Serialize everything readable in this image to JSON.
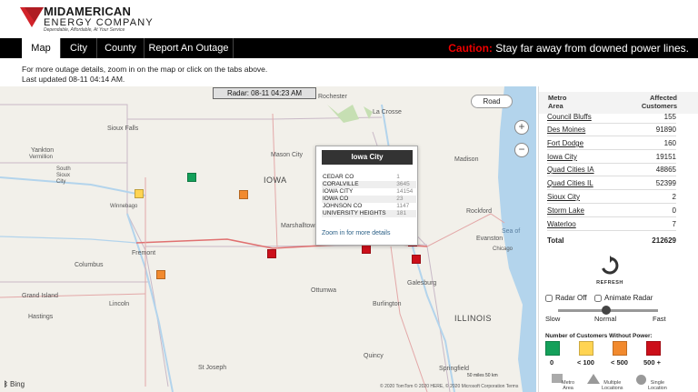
{
  "header": {
    "logo_line1": "MIDAMERICAN",
    "logo_line2": "ENERGY COMPANY",
    "logo_tagline": "Dependable, Affordable, At Your Service"
  },
  "nav": {
    "tabs": [
      {
        "label": "Map",
        "active": true
      },
      {
        "label": "City"
      },
      {
        "label": "County"
      },
      {
        "label": "Report An Outage"
      }
    ],
    "caution_word": "Caution:",
    "caution_text": "Stay far away from downed power lines."
  },
  "info": {
    "line1": "For more outage details, zoom in on the map or click on the tabs above.",
    "line2": "Last updated 08-11 04:14 AM."
  },
  "map": {
    "radar_label": "Radar: 08-11 04:23 AM",
    "road_button": "Road",
    "zoom_in": "+",
    "zoom_out": "−",
    "labels": {
      "sioux_falls": "Sioux Falls",
      "yankton": "Yankton",
      "vermillion": "Vermillion",
      "south_sioux": "South Sioux City",
      "mason_city": "Mason City",
      "iowa": "IOWA",
      "waterloo": "Waterloo",
      "marshalltown": "Marshalltown",
      "fort_dodge": "Fort Dodge",
      "winnebago": "Winnebago",
      "fremont": "Fremont",
      "columbus": "Columbus",
      "grand_island": "Grand Island",
      "lincoln": "Lincoln",
      "hastings": "Hastings",
      "ottumwa": "Ottumwa",
      "burlington": "Burlington",
      "galesburg": "Galesburg",
      "illinois": "ILLINOIS",
      "quincy": "Quincy",
      "springfield": "Springfield",
      "st_joseph": "St Joseph",
      "rochester": "Rochester",
      "la_crosse": "La Crosse",
      "madison": "Madison",
      "rockford": "Rockford",
      "evanston": "Evanston",
      "sea_of": "Sea of",
      "chicago": "Chicago"
    },
    "popup": {
      "title": "Iowa City",
      "rows": [
        [
          "CEDAR CO",
          "1"
        ],
        [
          "CORALVILLE",
          "3645"
        ],
        [
          "IOWA CITY",
          "14154"
        ],
        [
          "IOWA CO",
          "23"
        ],
        [
          "JOHNSON CO",
          "1147"
        ],
        [
          "UNIVERSITY HEIGHTS",
          "181"
        ]
      ],
      "link": "Zoom in for more details"
    },
    "bing": "Bing",
    "copyright": "© 2020 TomTom © 2020 HERE, © 2020 Microsoft Corporation  Terms",
    "scale": "50 miles  50 km"
  },
  "table": {
    "col1_line1": "Metro",
    "col1_line2": "Area",
    "col2_line1": "Affected",
    "col2_line2": "Customers",
    "rows": [
      [
        "Council Bluffs",
        "155"
      ],
      [
        "Des Moines",
        "91890"
      ],
      [
        "Fort Dodge",
        "160"
      ],
      [
        "Iowa City",
        "19151"
      ],
      [
        "Quad Cities IA",
        "48865"
      ],
      [
        "Quad Cities IL",
        "52399"
      ],
      [
        "Sioux City",
        "2"
      ],
      [
        "Storm Lake",
        "0"
      ],
      [
        "Waterloo",
        "7"
      ]
    ],
    "total_label": "Total",
    "total_value": "212629"
  },
  "controls": {
    "refresh": "REFRESH",
    "radar_off": "Radar Off",
    "animate_radar": "Animate Radar",
    "slow": "Slow",
    "normal": "Normal",
    "fast": "Fast"
  },
  "legend": {
    "title": "Number of Customers Without Power:",
    "items": [
      {
        "label": "0",
        "color": "#14a05a"
      },
      {
        "label": "< 100",
        "color": "#ffd452"
      },
      {
        "label": "< 500",
        "color": "#f28a2e"
      },
      {
        "label": "500 +",
        "color": "#cc0f1a"
      }
    ],
    "keys": [
      {
        "l1": "Metro",
        "l2": "Area"
      },
      {
        "l1": "Multiple",
        "l2": "Locations"
      },
      {
        "l1": "Single",
        "l2": "Location"
      }
    ]
  }
}
